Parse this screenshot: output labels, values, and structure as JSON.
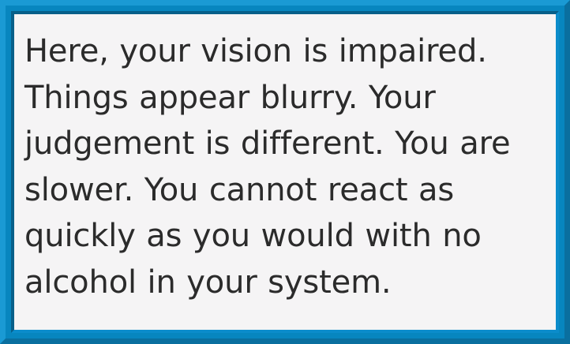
{
  "card": {
    "lines": [
      "Here, your vision is impaired.",
      "Things appear blurry. Your",
      "judgement is different. You are",
      "slower. You cannot react as",
      "quickly as you would with no",
      "alcohol in your system."
    ]
  },
  "colors": {
    "frame": "#0786bf",
    "background": "#f5f4f5",
    "text": "#2b2b2b"
  }
}
